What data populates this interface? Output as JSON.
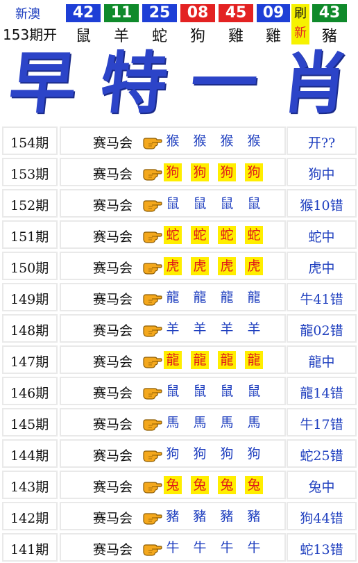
{
  "draw": {
    "region": "新澳",
    "issue": "153期开",
    "balls": [
      {
        "number": "42",
        "zodiac": "鼠",
        "color": "#1e3fd6"
      },
      {
        "number": "11",
        "zodiac": "羊",
        "color": "#0f8a2b"
      },
      {
        "number": "25",
        "zodiac": "蛇",
        "color": "#1e3fd6"
      },
      {
        "number": "08",
        "zodiac": "狗",
        "color": "#e32222"
      },
      {
        "number": "45",
        "zodiac": "雞",
        "color": "#e32222"
      },
      {
        "number": "09",
        "zodiac": "雞",
        "color": "#1e3fd6"
      }
    ],
    "refresh_label": "刷",
    "refresh_new": "新",
    "special": {
      "number": "43",
      "zodiac": "豬",
      "color": "#0f8a2b"
    }
  },
  "banner": {
    "title_chars": [
      "早",
      "特",
      "一",
      "肖"
    ],
    "color": "#2c44c8"
  },
  "rows": [
    {
      "issue": "154期",
      "club": "赛马会",
      "picks": [
        "猴",
        "猴",
        "猴",
        "猴"
      ],
      "hit": false,
      "result": "开??"
    },
    {
      "issue": "153期",
      "club": "赛马会",
      "picks": [
        "狗",
        "狗",
        "狗",
        "狗"
      ],
      "hit": true,
      "result": "狗中"
    },
    {
      "issue": "152期",
      "club": "赛马会",
      "picks": [
        "鼠",
        "鼠",
        "鼠",
        "鼠"
      ],
      "hit": false,
      "result": "猴10错"
    },
    {
      "issue": "151期",
      "club": "赛马会",
      "picks": [
        "蛇",
        "蛇",
        "蛇",
        "蛇"
      ],
      "hit": true,
      "result": "蛇中"
    },
    {
      "issue": "150期",
      "club": "赛马会",
      "picks": [
        "虎",
        "虎",
        "虎",
        "虎"
      ],
      "hit": true,
      "result": "虎中"
    },
    {
      "issue": "149期",
      "club": "赛马会",
      "picks": [
        "龍",
        "龍",
        "龍",
        "龍"
      ],
      "hit": false,
      "result": "牛41错"
    },
    {
      "issue": "148期",
      "club": "赛马会",
      "picks": [
        "羊",
        "羊",
        "羊",
        "羊"
      ],
      "hit": false,
      "result": "龍02错"
    },
    {
      "issue": "147期",
      "club": "赛马会",
      "picks": [
        "龍",
        "龍",
        "龍",
        "龍"
      ],
      "hit": true,
      "result": "龍中"
    },
    {
      "issue": "146期",
      "club": "赛马会",
      "picks": [
        "鼠",
        "鼠",
        "鼠",
        "鼠"
      ],
      "hit": false,
      "result": "龍14错"
    },
    {
      "issue": "145期",
      "club": "赛马会",
      "picks": [
        "馬",
        "馬",
        "馬",
        "馬"
      ],
      "hit": false,
      "result": "牛17错"
    },
    {
      "issue": "144期",
      "club": "赛马会",
      "picks": [
        "狗",
        "狗",
        "狗",
        "狗"
      ],
      "hit": false,
      "result": "蛇25错"
    },
    {
      "issue": "143期",
      "club": "赛马会",
      "picks": [
        "兔",
        "兔",
        "兔",
        "兔"
      ],
      "hit": true,
      "result": "兔中"
    },
    {
      "issue": "142期",
      "club": "赛马会",
      "picks": [
        "豬",
        "豬",
        "豬",
        "豬"
      ],
      "hit": false,
      "result": "狗44错"
    },
    {
      "issue": "141期",
      "club": "赛马会",
      "picks": [
        "牛",
        "牛",
        "牛",
        "牛"
      ],
      "hit": false,
      "result": "蛇13错"
    }
  ]
}
